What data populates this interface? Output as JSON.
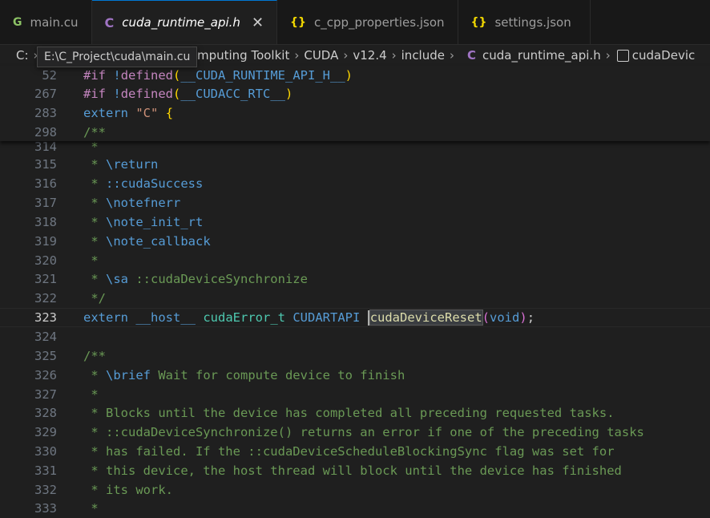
{
  "tabs": [
    {
      "icon": "cu",
      "label": "main.cu",
      "active": false
    },
    {
      "icon": "c",
      "label": "cuda_runtime_api.h",
      "active": true
    },
    {
      "icon": "json",
      "label": "c_cpp_properties.json",
      "active": false
    },
    {
      "icon": "json",
      "label": "settings.json",
      "active": false
    }
  ],
  "icons": {
    "cu": "G",
    "c": "C",
    "json": "{}",
    "close": "✕"
  },
  "breadcrumb": {
    "drive": "C:",
    "items": [
      "PU Computing Toolkit",
      "CUDA",
      "v12.4",
      "include"
    ],
    "file": "cuda_runtime_api.h",
    "symbol": "cudaDevic"
  },
  "tooltip": "E:\\C_Project\\cuda\\main.cu",
  "sticky": [
    {
      "num": "52",
      "text": "#if !defined(__CUDA_RUNTIME_API_H__)"
    },
    {
      "num": "267",
      "text": "#if !defined(__CUDACC_RTC__)"
    },
    {
      "num": "283",
      "text": "extern \"C\" {"
    },
    {
      "num": "298",
      "text": "/**"
    }
  ],
  "lines": [
    {
      "num": "314",
      "text": " *"
    },
    {
      "num": "315",
      "text": " * \\return"
    },
    {
      "num": "316",
      "text": " * ::cudaSuccess"
    },
    {
      "num": "317",
      "text": " * \\notefnerr"
    },
    {
      "num": "318",
      "text": " * \\note_init_rt"
    },
    {
      "num": "319",
      "text": " * \\note_callback"
    },
    {
      "num": "320",
      "text": " *"
    },
    {
      "num": "321",
      "text": " * \\sa ::cudaDeviceSynchronize"
    },
    {
      "num": "322",
      "text": " */"
    },
    {
      "num": "323",
      "text": "extern __host__ cudaError_t CUDARTAPI cudaDeviceReset(void);"
    },
    {
      "num": "324",
      "text": ""
    },
    {
      "num": "325",
      "text": "/**"
    },
    {
      "num": "326",
      "text": " * \\brief Wait for compute device to finish"
    },
    {
      "num": "327",
      "text": " *"
    },
    {
      "num": "328",
      "text": " * Blocks until the device has completed all preceding requested tasks."
    },
    {
      "num": "329",
      "text": " * ::cudaDeviceSynchronize() returns an error if one of the preceding tasks"
    },
    {
      "num": "330",
      "text": " * has failed. If the ::cudaDeviceScheduleBlockingSync flag was set for"
    },
    {
      "num": "331",
      "text": " * this device, the host thread will block until the device has finished"
    },
    {
      "num": "332",
      "text": " * its work."
    },
    {
      "num": "333",
      "text": " *"
    }
  ],
  "current_line": "323"
}
